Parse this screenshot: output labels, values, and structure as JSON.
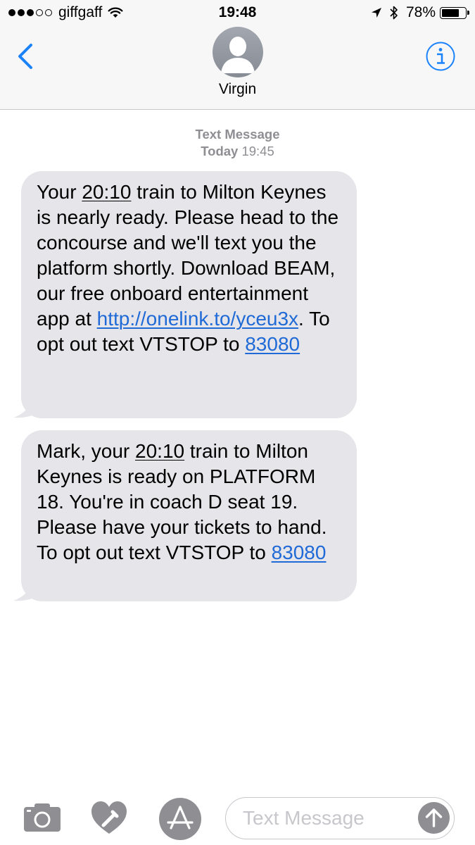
{
  "status_bar": {
    "carrier": "giffgaff",
    "time": "19:48",
    "battery": "78%",
    "battery_level": 0.78,
    "signal_bars_filled": 3,
    "signal_bars_total": 5
  },
  "header": {
    "contact_name": "Virgin"
  },
  "conversation": {
    "meta_type": "Text Message",
    "meta_day": "Today",
    "meta_time": "19:45",
    "messages": [
      {
        "p1": "Your ",
        "time": "20:10",
        "p2": " train to Milton Keynes is nearly ready. Please head to the concourse and we'll text you the platform shortly. Download BEAM, our free onboard entertainment app at ",
        "link": "http://onelink.to/yceu3x",
        "p3": ". To opt out text VTSTOP to ",
        "number": "83080"
      },
      {
        "p1": "Mark, your ",
        "time": "20:10",
        "p2": " train to Milton Keynes is ready on PLATFORM 18. You're in coach D seat 19. Please have your tickets to hand. To opt out text VTSTOP to ",
        "number": "83080"
      }
    ]
  },
  "input_bar": {
    "placeholder": "Text Message"
  },
  "colors": {
    "accent": "#1a82fb",
    "bubble": "#e5e5ea",
    "link": "#1f6ad6",
    "meta_text": "#8e8e93"
  }
}
